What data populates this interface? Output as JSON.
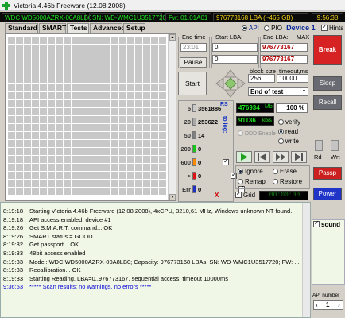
{
  "window": {
    "title": "Victoria 4.46b Freeware (12.08.2008)"
  },
  "status_bar": {
    "drive": "WDC WD5000AZRX-00A8LB0",
    "serial": "SN: WD-WMC1U3517720",
    "firmware": "Fw: 01.01A01",
    "lba": "976773168 LBA (~465 GB)",
    "time": "9:56:38"
  },
  "tabs": [
    "Standard",
    "SMART",
    "Tests",
    "Advanced",
    "Setup"
  ],
  "active_tab": "Tests",
  "mode": {
    "api": "API",
    "pio": "PIO",
    "device": "Device 1",
    "hints": "Hints"
  },
  "timing": {
    "end_time_label": "End time",
    "end_time_value": "23:01",
    "start_lba_label": "Start LBA:",
    "start_lba_value": "0",
    "end_lba_label": "End LBA:",
    "max_label": "MAX",
    "end_lba_value": "976773167",
    "current_lba_left": "0",
    "current_lba_right": "976773167",
    "pause": "Pause",
    "start": "Start"
  },
  "settings": {
    "block_size_label": "block size",
    "block_size": "256",
    "timeout_label": "timeout,ms",
    "timeout": "10000",
    "end_action": "End of test"
  },
  "counters": [
    {
      "label": "5",
      "value": "3561886",
      "color": "#c8c8c8"
    },
    {
      "label": "20",
      "value": "253622",
      "color": "#a8a8a8"
    },
    {
      "label": "50",
      "value": "14",
      "color": "#808080"
    },
    {
      "label": "200",
      "value": "0",
      "color": "#19c419"
    },
    {
      "label": "600",
      "value": "0",
      "color": "#ff8a00"
    },
    {
      "label": ">",
      "value": "0",
      "color": "#e01010"
    },
    {
      "label": "Err",
      "value": "0",
      "color": "#2030c0"
    }
  ],
  "counters_extra": {
    "rs": "RS",
    "to_log": "to log:",
    "err_x": "X"
  },
  "readout": {
    "mb": "476934",
    "mb_unit": "Mb",
    "percent": "100",
    "percent_unit": "%",
    "speed": "91136",
    "speed_unit": "kb/s",
    "ddd": "DDD Enable",
    "verify": "verify",
    "read": "read",
    "write": "write"
  },
  "actions": {
    "ignore": "Ignore",
    "erase": "Erase",
    "remap": "Remap",
    "restore": "Restore",
    "grid": "Grid",
    "grid_timer": "00:00:00"
  },
  "right_panel": {
    "break_all": "Break All",
    "sleep": "Sleep",
    "recall": "Recall",
    "rd": "Rd",
    "wrt": "Wrt",
    "passp": "Passp",
    "power": "Power",
    "sound": "sound",
    "api_number_label": "API number",
    "api_number": "1"
  },
  "log": [
    {
      "time": "8:19:18",
      "text": "Starting Victoria 4.46b Freeware (12.08.2008), 4xCPU, 3210,61 MHz, Windows unknown NT found."
    },
    {
      "time": "8:19:18",
      "text": "API access enabled, device #1"
    },
    {
      "time": "8:19:26",
      "text": "Get S.M.A.R.T. command... OK"
    },
    {
      "time": "8:19:26",
      "text": "SMART status = GOOD"
    },
    {
      "time": "8:19:32",
      "text": "Get passport... OK"
    },
    {
      "time": "8:19:33",
      "text": "48bit access enabled"
    },
    {
      "time": "8:19:33",
      "text": "Model: WDC WD5000AZRX-00A8LB0; Capacity: 976773168 LBAs; SN: WD-WMC1U3517720; FW: ..."
    },
    {
      "time": "8:19:33",
      "text": "Recallibration... OK"
    },
    {
      "time": "8:19:33",
      "text": "Starting Reading, LBA=0..976773167, sequential access, timeout 10000ms"
    },
    {
      "time": "9:36:53",
      "text": "***** Scan results: no warnings, no errors *****",
      "highlight": true
    }
  ]
}
